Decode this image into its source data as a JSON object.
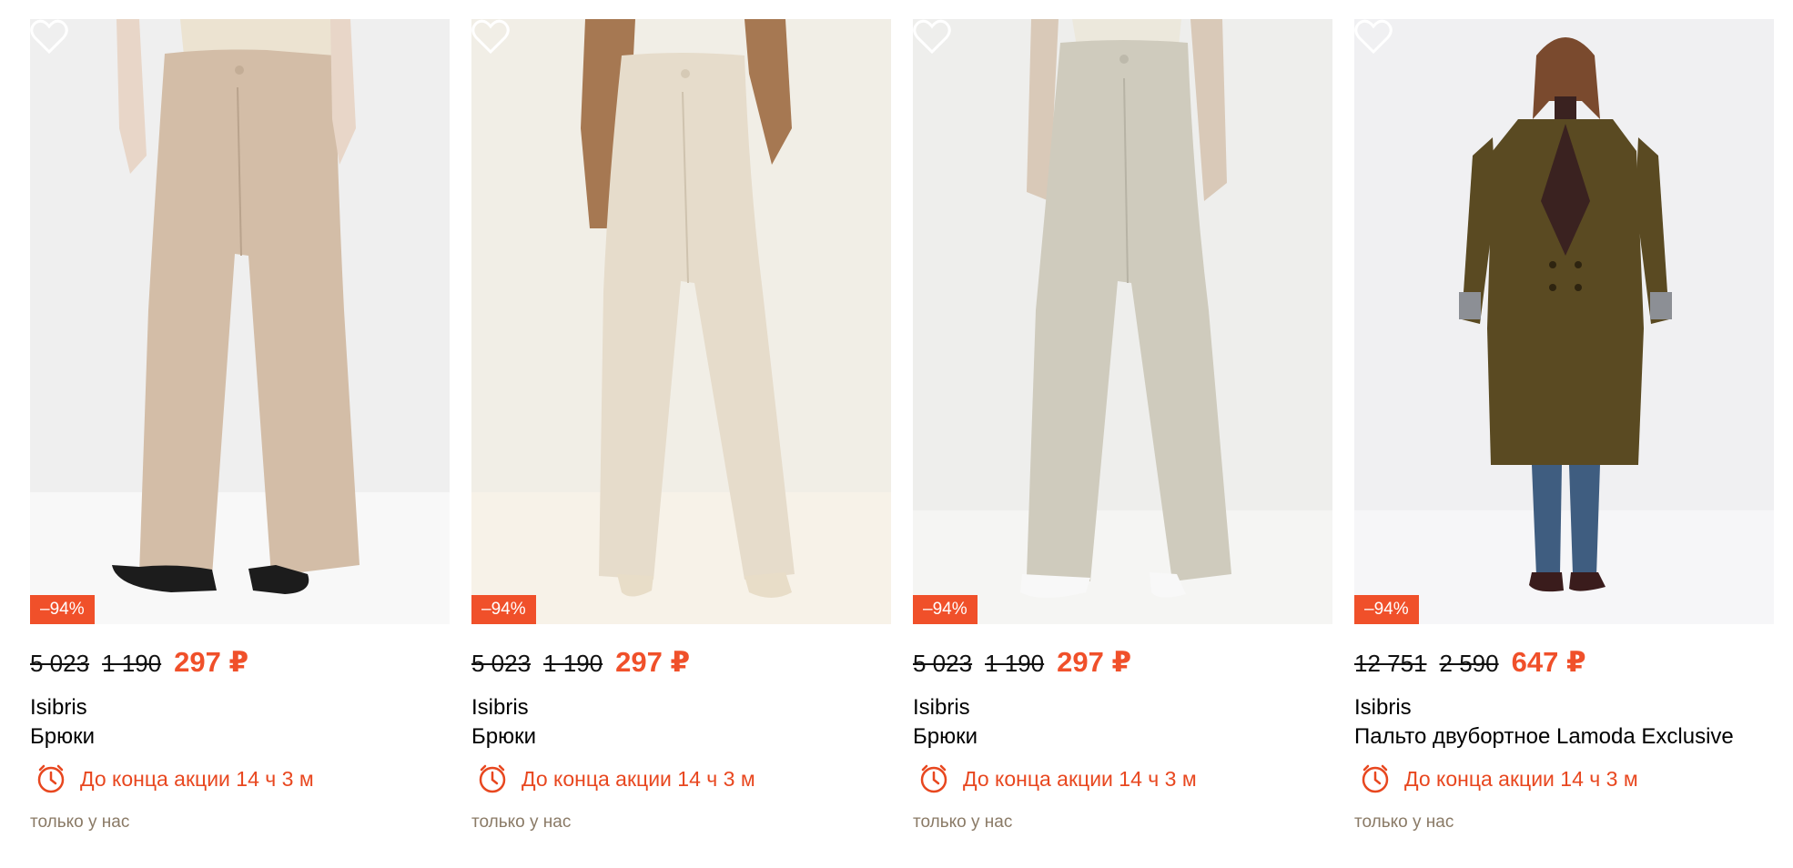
{
  "accent_color": "#f0502a",
  "products": [
    {
      "discount": "–94%",
      "old_prices": [
        "5 023",
        "1 190"
      ],
      "price": "297 ₽",
      "brand": "Isibris",
      "name": "Брюки",
      "timer_text": "До конца акции 14 ч 3 м",
      "tag": "только у нас",
      "image_colors": {
        "bg": "#efefef",
        "item": "#d3bda7",
        "top": "#ece3d1",
        "shoes": "#1c1c1c"
      },
      "icon": "clock-icon"
    },
    {
      "discount": "–94%",
      "old_prices": [
        "5 023",
        "1 190"
      ],
      "price": "297 ₽",
      "brand": "Isibris",
      "name": "Брюки",
      "timer_text": "До конца акции 14 ч 3 м",
      "tag": "только у нас",
      "image_colors": {
        "bg": "#f1eee6",
        "item": "#e6dccb",
        "top": "#a67852",
        "shoes": "#e8ddc8"
      },
      "icon": "clock-icon"
    },
    {
      "discount": "–94%",
      "old_prices": [
        "5 023",
        "1 190"
      ],
      "price": "297 ₽",
      "brand": "Isibris",
      "name": "Брюки",
      "timer_text": "До конца акции 14 ч 3 м",
      "tag": "только у нас",
      "image_colors": {
        "bg": "#eeeeec",
        "item": "#cfcbbd",
        "top": "#ece8dc",
        "shoes": "#f5f5f5"
      },
      "icon": "clock-icon"
    },
    {
      "discount": "–94%",
      "old_prices": [
        "12 751",
        "2 590"
      ],
      "price": "647 ₽",
      "brand": "Isibris",
      "name": "Пальто двубортное Lamoda Exclusive",
      "timer_text": "До конца акции 14 ч 3 м",
      "tag": "только у нас",
      "image_colors": {
        "bg": "#f0f0f2",
        "item": "#5a4a22",
        "top": "#3a2220",
        "shoes": "#3a1c1c",
        "jeans": "#3f5d80"
      },
      "icon": "clock-icon"
    }
  ]
}
